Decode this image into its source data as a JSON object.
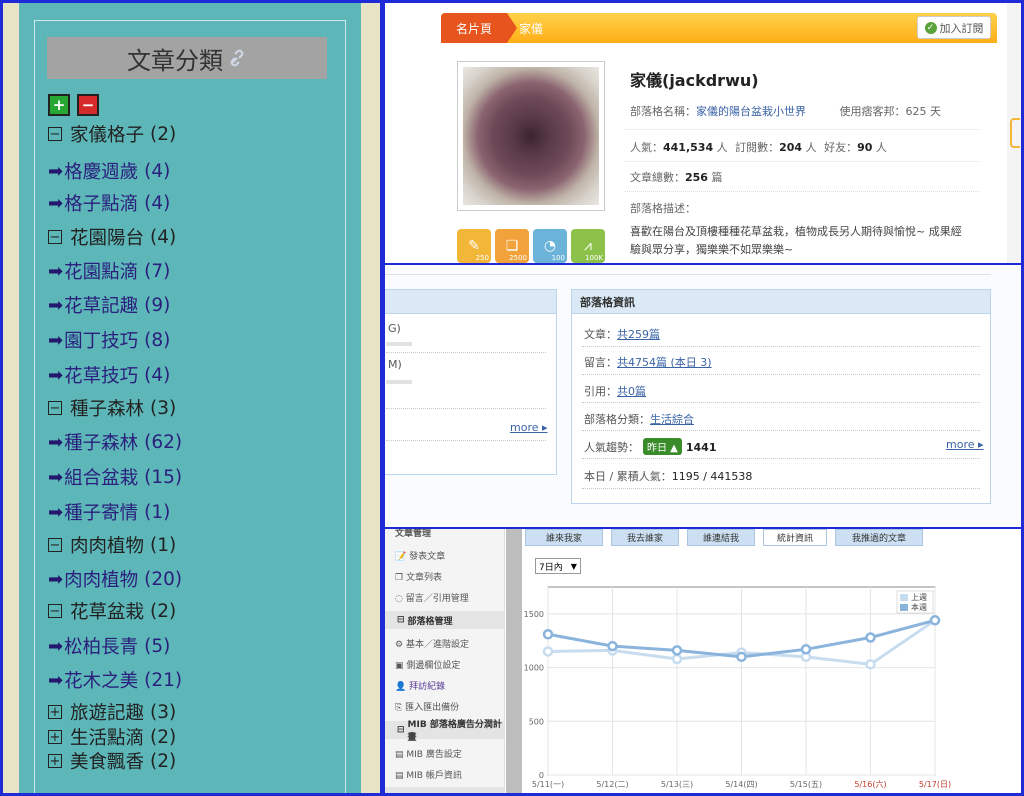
{
  "categories": {
    "title": "文章分類",
    "items": [
      {
        "label": "家儀格子",
        "count": "(2)",
        "type": "parent",
        "toggle": "−"
      },
      {
        "label": "格慶週歲",
        "count": "(4)",
        "type": "child"
      },
      {
        "label": "格子點滴",
        "count": "(4)",
        "type": "child"
      },
      {
        "label": "花園陽台",
        "count": "(4)",
        "type": "parent",
        "toggle": "−"
      },
      {
        "label": "花園點滴",
        "count": "(7)",
        "type": "child"
      },
      {
        "label": "花草記趣",
        "count": "(9)",
        "type": "child"
      },
      {
        "label": "園丁技巧",
        "count": "(8)",
        "type": "child"
      },
      {
        "label": "花草技巧",
        "count": "(4)",
        "type": "child"
      },
      {
        "label": "種子森林",
        "count": "(3)",
        "type": "parent",
        "toggle": "−"
      },
      {
        "label": "種子森林",
        "count": "(62)",
        "type": "child"
      },
      {
        "label": "組合盆栽",
        "count": "(15)",
        "type": "child"
      },
      {
        "label": "種子寄情",
        "count": "(1)",
        "type": "child"
      },
      {
        "label": "肉肉植物",
        "count": "(1)",
        "type": "parent",
        "toggle": "−"
      },
      {
        "label": "肉肉植物",
        "count": "(20)",
        "type": "child"
      },
      {
        "label": "花草盆栽",
        "count": "(2)",
        "type": "parent",
        "toggle": "−"
      },
      {
        "label": "松柏長青",
        "count": "(5)",
        "type": "child"
      },
      {
        "label": "花木之美",
        "count": "(21)",
        "type": "child"
      },
      {
        "label": "旅遊記趣",
        "count": "(3)",
        "type": "parent",
        "toggle": "+"
      },
      {
        "label": "生活點滴",
        "count": "(2)",
        "type": "parent",
        "toggle": "+"
      },
      {
        "label": "美食飄香",
        "count": "(2)",
        "type": "parent",
        "toggle": "+"
      }
    ]
  },
  "profile": {
    "tab1": "名片頁",
    "tab2": "家儀",
    "subscribe": "加入訂閱",
    "name": "家儀(jackdrwu)",
    "blog_name_label": "部落格名稱：",
    "blog_name": "家儀的陽台盆栽小世界",
    "used_label": "使用痞客邦：",
    "used_days": "625 天",
    "popularity_label": "人氣：",
    "popularity": "441,534",
    "popularity_unit": "人",
    "subscribers_label": "訂閱數：",
    "subscribers": "204",
    "subscribers_unit": "人",
    "friends_label": "好友：",
    "friends": "90",
    "friends_unit": "人",
    "articles_label": "文章總數：",
    "articles": "256",
    "articles_unit": "篇",
    "desc_label": "部落格描述：",
    "desc1": "喜歡在陽台及頂樓種種花草盆栽，植物成長另人期待與愉悅~ 成果經",
    "desc2": "驗與眾分享，獨樂樂不如眾樂樂~",
    "icon_counts": [
      "250",
      "2500",
      "100",
      "100K"
    ]
  },
  "blog_info": {
    "left_g": "G)",
    "left_m": "M)",
    "left_more": "more",
    "title": "部落格資訊",
    "articles_label": "文章：",
    "articles": "共259篇",
    "comments_label": "留言：",
    "comments": "共4754篇 (本日 3)",
    "refs_label": "引用：",
    "refs": "共0篇",
    "category_label": "部落格分類：",
    "category": "生活綜合",
    "trend_label": "人氣趨勢：",
    "trend_badge": "昨日",
    "trend_value": "1441",
    "more": "more",
    "today_label": "本日 / 累積人氣：",
    "today_value": "1195 / 441538"
  },
  "admin": {
    "top_cut": "文章管理",
    "items1": [
      "發表文章",
      "文章列表",
      "留言／引用管理"
    ],
    "section2": "部落格管理",
    "items2": [
      "基本／進階設定",
      "側邊欄位設定",
      "拜訪紀錄",
      "匯入匯出備份"
    ],
    "section3": "MIB 部落格廣告分潤計畫",
    "items3": [
      "MIB 廣告設定",
      "MIB 帳戶資訊"
    ],
    "tabs": [
      "誰來我家",
      "我去誰家",
      "誰連結我",
      "統計資訊",
      "我推過的文章"
    ],
    "active_tab": 3,
    "range": "7日內",
    "legend": [
      "上週",
      "本週"
    ]
  },
  "chart_data": {
    "type": "line",
    "categories": [
      "5/11(一)",
      "5/12(二)",
      "5/13(三)",
      "5/14(四)",
      "5/15(五)",
      "5/16(六)",
      "5/17(日)"
    ],
    "series": [
      {
        "name": "上週",
        "values": [
          1150,
          1160,
          1080,
          1140,
          1100,
          1030,
          1440
        ],
        "color": "#c7dcee"
      },
      {
        "name": "本週",
        "values": [
          1310,
          1200,
          1160,
          1100,
          1170,
          1280,
          1440
        ],
        "color": "#8ab4dc"
      }
    ],
    "ylim": [
      0,
      1750
    ],
    "yticks": [
      0,
      500,
      1000,
      1500
    ],
    "weekend_color": "#c0392b"
  }
}
